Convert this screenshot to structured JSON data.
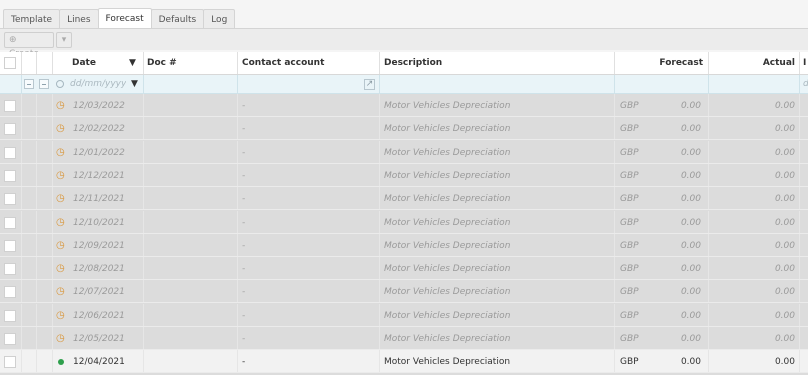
{
  "tabs": [
    "Template",
    "Lines",
    "Forecast",
    "Defaults",
    "Log"
  ],
  "active_tab": "Forecast",
  "toolbar": {
    "create_label": "Create",
    "create_icon": "plus-circle-icon",
    "menu_icon": "caret-down-icon"
  },
  "columns": {
    "date": "Date",
    "doc": "Doc #",
    "contact": "Contact account",
    "description": "Description",
    "forecast": "Forecast",
    "actual": "Actual",
    "next_partial": "I"
  },
  "filter": {
    "date_placeholder": "dd/mm/yyyy",
    "next_placeholder": "d"
  },
  "rows": [
    {
      "date": "12/03/2022",
      "contact": "-",
      "description": "Motor Vehicles Depreciation",
      "currency": "GBP",
      "forecast": "0.00",
      "actual": "0.00",
      "status": "pending"
    },
    {
      "date": "12/02/2022",
      "contact": "-",
      "description": "Motor Vehicles Depreciation",
      "currency": "GBP",
      "forecast": "0.00",
      "actual": "0.00",
      "status": "pending"
    },
    {
      "date": "12/01/2022",
      "contact": "-",
      "description": "Motor Vehicles Depreciation",
      "currency": "GBP",
      "forecast": "0.00",
      "actual": "0.00",
      "status": "pending"
    },
    {
      "date": "12/12/2021",
      "contact": "-",
      "description": "Motor Vehicles Depreciation",
      "currency": "GBP",
      "forecast": "0.00",
      "actual": "0.00",
      "status": "pending"
    },
    {
      "date": "12/11/2021",
      "contact": "-",
      "description": "Motor Vehicles Depreciation",
      "currency": "GBP",
      "forecast": "0.00",
      "actual": "0.00",
      "status": "pending"
    },
    {
      "date": "12/10/2021",
      "contact": "-",
      "description": "Motor Vehicles Depreciation",
      "currency": "GBP",
      "forecast": "0.00",
      "actual": "0.00",
      "status": "pending"
    },
    {
      "date": "12/09/2021",
      "contact": "-",
      "description": "Motor Vehicles Depreciation",
      "currency": "GBP",
      "forecast": "0.00",
      "actual": "0.00",
      "status": "pending"
    },
    {
      "date": "12/08/2021",
      "contact": "-",
      "description": "Motor Vehicles Depreciation",
      "currency": "GBP",
      "forecast": "0.00",
      "actual": "0.00",
      "status": "pending"
    },
    {
      "date": "12/07/2021",
      "contact": "-",
      "description": "Motor Vehicles Depreciation",
      "currency": "GBP",
      "forecast": "0.00",
      "actual": "0.00",
      "status": "pending"
    },
    {
      "date": "12/06/2021",
      "contact": "-",
      "description": "Motor Vehicles Depreciation",
      "currency": "GBP",
      "forecast": "0.00",
      "actual": "0.00",
      "status": "pending"
    },
    {
      "date": "12/05/2021",
      "contact": "-",
      "description": "Motor Vehicles Depreciation",
      "currency": "GBP",
      "forecast": "0.00",
      "actual": "0.00",
      "status": "pending"
    },
    {
      "date": "12/04/2021",
      "contact": "-",
      "description": "Motor Vehicles Depreciation",
      "currency": "GBP",
      "forecast": "0.00",
      "actual": "0.00",
      "status": "done"
    }
  ],
  "colors": {
    "pending_icon": "#d9963a",
    "done_dot": "#2e9f4c",
    "filter_row": "#e9f4f8"
  }
}
